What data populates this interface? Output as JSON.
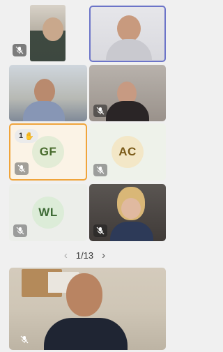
{
  "participants": [
    {
      "id": "p1",
      "type": "video",
      "muted": true
    },
    {
      "id": "p2",
      "type": "video",
      "muted": false,
      "active_speaker": true
    },
    {
      "id": "p3",
      "type": "video",
      "muted": false
    },
    {
      "id": "p4",
      "type": "video",
      "muted": true
    },
    {
      "id": "p5",
      "type": "avatar",
      "initials": "GF",
      "muted": true,
      "hand_raised": true,
      "hand_count": "1",
      "hand_icon": "✋",
      "avatar_color": "#e3ecd6",
      "text_color": "#486b2d"
    },
    {
      "id": "p6",
      "type": "avatar",
      "initials": "AC",
      "muted": true,
      "avatar_color": "#f3e7c7",
      "text_color": "#7a5a18"
    },
    {
      "id": "p7",
      "type": "avatar",
      "initials": "WL",
      "muted": true,
      "avatar_color": "#dcecd8",
      "text_color": "#3d6a35"
    },
    {
      "id": "p8",
      "type": "video",
      "muted": true
    }
  ],
  "pager": {
    "label": "1/13",
    "prev_icon": "‹",
    "next_icon": "›"
  },
  "self_view": {
    "type": "video",
    "muted": true
  },
  "colors": {
    "active_border": "#6c74c8",
    "hand_border": "#f0a43a",
    "background": "#f0f0f0"
  }
}
